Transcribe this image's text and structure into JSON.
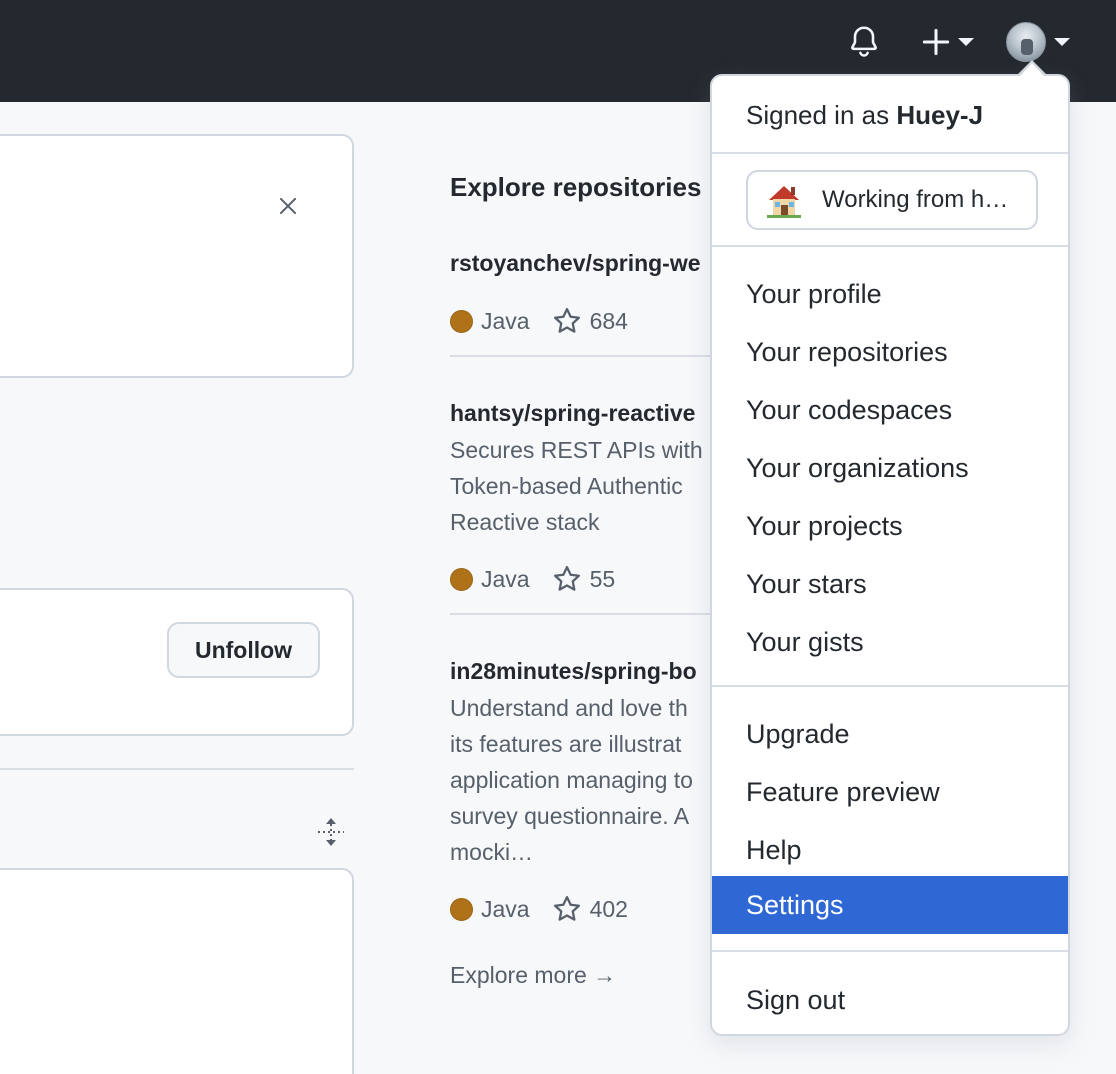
{
  "header": {
    "icons": [
      "bell-icon",
      "plus-icon",
      "avatar"
    ]
  },
  "left": {
    "unfollow_label": "Unfollow"
  },
  "explore": {
    "title": "Explore repositories",
    "repos": [
      {
        "name": "rstoyanchev/spring-we",
        "description": "",
        "language": "Java",
        "stars": "684"
      },
      {
        "name": "hantsy/spring-reactive",
        "description": "Secures REST APIs with Token-based Authentic Reactive stack",
        "language": "Java",
        "stars": "55"
      },
      {
        "name": "in28minutes/spring-bo",
        "description": "Understand and love th its features are illustrat application managing to survey questionnaire. A mocki…",
        "language": "Java",
        "stars": "402"
      }
    ],
    "more_label": "Explore more →"
  },
  "dropdown": {
    "signed_in_prefix": "Signed in as",
    "username": "Huey-J",
    "status_text": "Working from h…",
    "group1": [
      "Your profile",
      "Your repositories",
      "Your codespaces",
      "Your organizations",
      "Your projects",
      "Your stars",
      "Your gists"
    ],
    "group2": [
      "Upgrade",
      "Feature preview",
      "Help",
      "Settings"
    ],
    "active_item": "Settings",
    "sign_out": "Sign out"
  },
  "colors": {
    "header_bg": "#24292f",
    "accent": "#2f68d4",
    "java": "#b07219"
  }
}
